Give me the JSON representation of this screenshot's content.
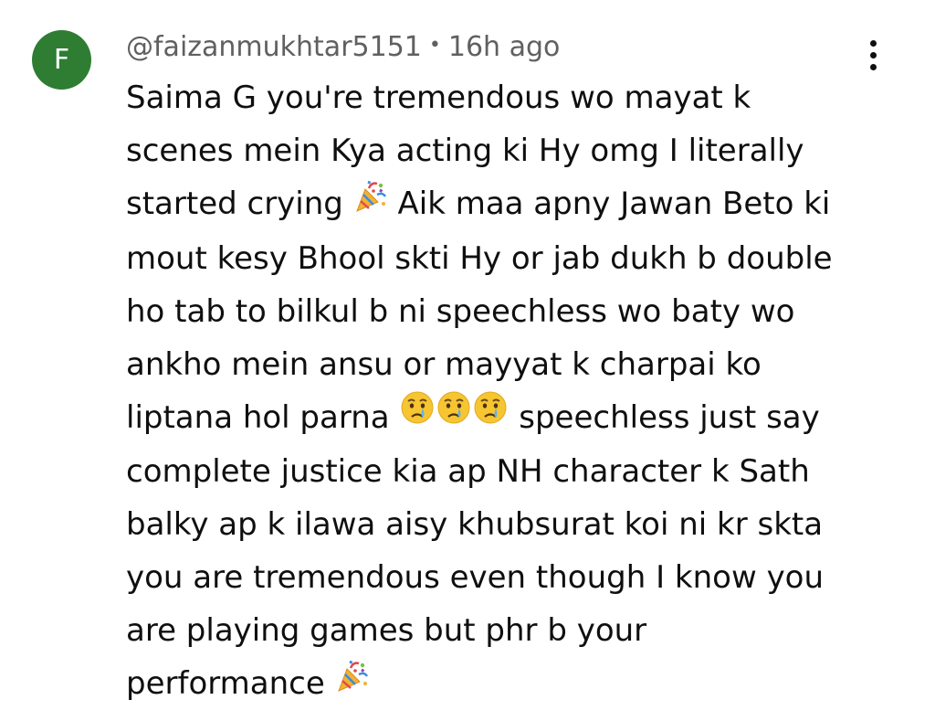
{
  "avatar": {
    "letter": "F",
    "color": "#2e7d32"
  },
  "comment": {
    "author": "@faizanmukhtar5151",
    "separator": "•",
    "time": "16h ago",
    "menu_icon": "more-vert-icon",
    "lines": [
      {
        "segments": [
          {
            "type": "text",
            "value": "Saima G you're tremendous wo mayat k"
          }
        ]
      },
      {
        "segments": [
          {
            "type": "text",
            "value": "scenes mein Kya acting ki Hy omg I literally"
          }
        ]
      },
      {
        "segments": [
          {
            "type": "text",
            "value": "started crying "
          },
          {
            "type": "emoji",
            "name": "party-popper-icon"
          },
          {
            "type": "text",
            "value": " Aik maa apny Jawan Beto ki"
          }
        ]
      },
      {
        "segments": [
          {
            "type": "text",
            "value": "mout kesy Bhool skti Hy or jab dukh b double"
          }
        ]
      },
      {
        "segments": [
          {
            "type": "text",
            "value": "ho tab to bilkul b ni speechless wo baty wo"
          }
        ]
      },
      {
        "segments": [
          {
            "type": "text",
            "value": "ankho mein ansu or mayyat k charpai ko"
          }
        ]
      },
      {
        "segments": [
          {
            "type": "text",
            "value": "liptana hol parna "
          },
          {
            "type": "emoji",
            "name": "crying-face-icon"
          },
          {
            "type": "emoji",
            "name": "crying-face-icon"
          },
          {
            "type": "emoji",
            "name": "crying-face-icon"
          },
          {
            "type": "text",
            "value": " speechless just say"
          }
        ]
      },
      {
        "segments": [
          {
            "type": "text",
            "value": "complete justice kia ap NH character k Sath"
          }
        ]
      },
      {
        "segments": [
          {
            "type": "text",
            "value": "balky ap k ilawa aisy khubsurat koi ni kr skta"
          }
        ]
      },
      {
        "segments": [
          {
            "type": "text",
            "value": "you are tremendous even though I know you"
          }
        ]
      },
      {
        "segments": [
          {
            "type": "text",
            "value": "are playing games but phr b your"
          }
        ]
      },
      {
        "segments": [
          {
            "type": "text",
            "value": "performance "
          },
          {
            "type": "emoji",
            "name": "party-popper-icon"
          }
        ]
      }
    ]
  }
}
